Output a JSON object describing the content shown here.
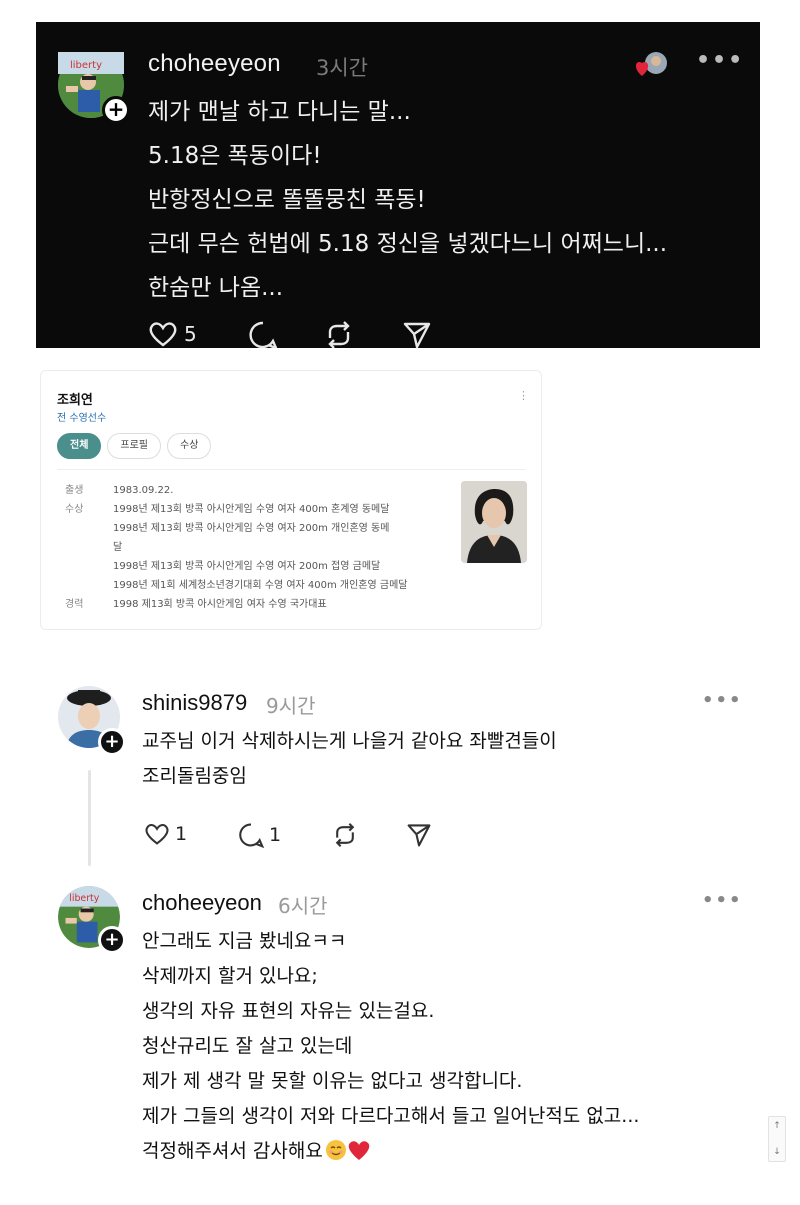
{
  "post": {
    "username": "choheeyeon",
    "time": "3시간",
    "more": "•••",
    "lines": [
      "제가 맨날 하고 다니는 말...",
      "5.18은 폭동이다!",
      "반항정신으로 똘똘뭉친 폭동!",
      "근데 무슨 헌법에 5.18 정신을 넣겠다느니 어쩌느니...",
      "한숨만 나옴..."
    ],
    "like_count": "5",
    "icons": [
      "heart-icon",
      "comment-icon",
      "repost-icon",
      "share-icon",
      "heart-reaction-icon"
    ]
  },
  "card": {
    "name": "조희연",
    "subtitle": "전 수영선수",
    "kebab": "⋮",
    "tabs": [
      "전체",
      "프로필",
      "수상"
    ],
    "rows": [
      {
        "key": "출생",
        "value": "1983.09.22."
      },
      {
        "key": "수상",
        "value": "1998년 제13회 방콕 아시안게임 수영 여자 400m 혼계영 동메달"
      },
      {
        "key": "",
        "value": "1998년 제13회 방콕 아시안게임 수영 여자 200m 개인혼영 동메"
      },
      {
        "key": "",
        "value": "달"
      },
      {
        "key": "",
        "value": "1998년 제13회 방콕 아시안게임 수영 여자 200m 접영 금메달"
      },
      {
        "key": "",
        "value": "1998년 제1회 세계청소년경기대회 수영 여자 400m 개인혼영 금메달"
      },
      {
        "key": "경력",
        "value": "1998 제13회 방콕 아시안게임 여자 수영 국가대표"
      }
    ]
  },
  "comment1": {
    "username": "shinis9879",
    "time": "9시간",
    "more": "•••",
    "lines": [
      "교주님 이거 삭제하시는게 나을거 같아요 좌빨견들이",
      "조리돌림중임"
    ],
    "like_count": "1",
    "reply_count": "1"
  },
  "comment2": {
    "username": "choheeyeon",
    "time": "6시간",
    "more": "•••",
    "lines": [
      "안그래도 지금 봤네요ㅋㅋ",
      "삭제까지 할거 있나요;",
      "생각의 자유 표현의 자유는 있는걸요.",
      "청산규리도 잘 살고 있는데",
      "제가 제 생각 말 못할 이유는 없다고 생각합니다.",
      "제가 그들의 생각이 저와 다르다고해서 들고 일어난적도 없고...",
      "걱정해주셔서 감사해요"
    ],
    "emoji": [
      "smiling-face-emoji",
      "red-heart-emoji"
    ]
  },
  "scrollbar": {
    "up": "↑",
    "down": "↓"
  }
}
